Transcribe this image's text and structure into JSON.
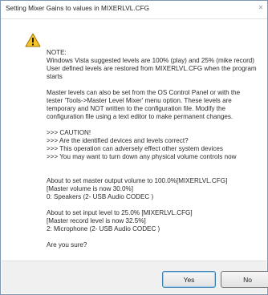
{
  "window": {
    "title": "Setting Mixer Gains to values in MIXERLVL.CFG",
    "close_glyph": "✕"
  },
  "icon": "warning-icon",
  "colors": {
    "warning_fill": "#f6c324",
    "warning_stroke": "#a07608",
    "accent": "#3c7fb1"
  },
  "message": {
    "p1": [
      "NOTE:",
      "Windows Vista suggested levels are 100% (play) and 25% (mike record)",
      "User defined levels are restored from MIXERLVL.CFG when the program",
      "starts"
    ],
    "p2": [
      "Master levels can also be set from the OS Control Panel or with the",
      "tester 'Tools->Master Level Mixer' menu option.  These levels are",
      "temporary and NOT written to the configuration file.  Modify the",
      "configuration file using a text editor to make permanent changes."
    ],
    "p3": [
      ">>> CAUTION!",
      ">>> Are the identified devices and levels correct?",
      ">>> This operation can adversely effect other system devices",
      ">>> You may want to turn down any physical volume controls now"
    ],
    "p4": [
      "About to set master output volume to 100.0%[MIXERLVL.CFG]",
      "[Master volume is now 30.0%]",
      " 0: Speakers (2- USB Audio CODEC )"
    ],
    "p5": [
      "About to set input level to 25.0% [MIXERLVL.CFG]",
      "[Master record level is now 32.5%]",
      "2: Microphone (2- USB Audio CODEC )"
    ],
    "p6": [
      "Are you sure?"
    ]
  },
  "buttons": {
    "yes": "Yes",
    "no": "No"
  }
}
